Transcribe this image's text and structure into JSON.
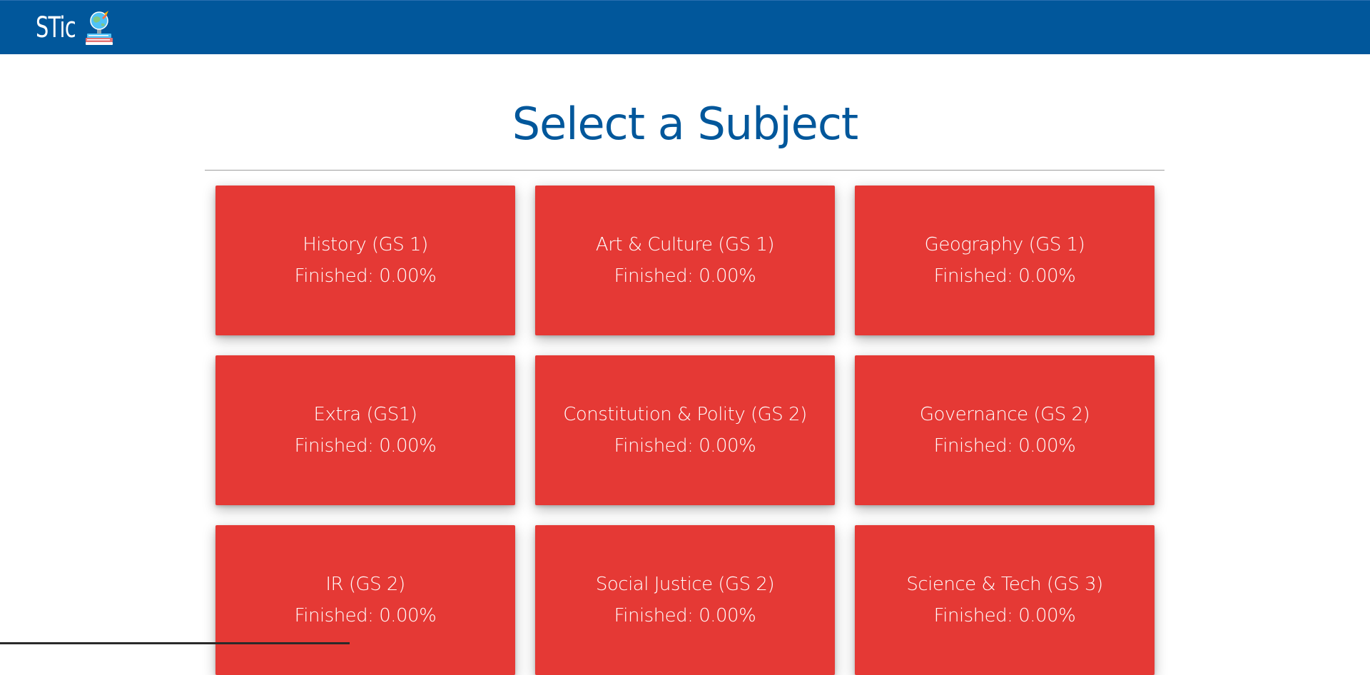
{
  "header": {
    "logo_text": "STic",
    "logo_icon": "globe-rocket-books-icon",
    "bar_color": "#01579b"
  },
  "main": {
    "title": "Select a Subject",
    "card_color": "#e53935",
    "subjects": [
      {
        "name": "History (GS 1)",
        "progress": "Finished: 0.00%"
      },
      {
        "name": "Art & Culture (GS 1)",
        "progress": "Finished: 0.00%"
      },
      {
        "name": "Geography (GS 1)",
        "progress": "Finished: 0.00%"
      },
      {
        "name": "Extra (GS1)",
        "progress": "Finished: 0.00%"
      },
      {
        "name": "Constitution & Polity (GS 2)",
        "progress": "Finished: 0.00%"
      },
      {
        "name": "Governance (GS 2)",
        "progress": "Finished: 0.00%"
      },
      {
        "name": "IR (GS 2)",
        "progress": "Finished: 0.00%"
      },
      {
        "name": "Social Justice (GS 2)",
        "progress": "Finished: 0.00%"
      },
      {
        "name": "Science & Tech (GS 3)",
        "progress": "Finished: 0.00%"
      }
    ]
  }
}
